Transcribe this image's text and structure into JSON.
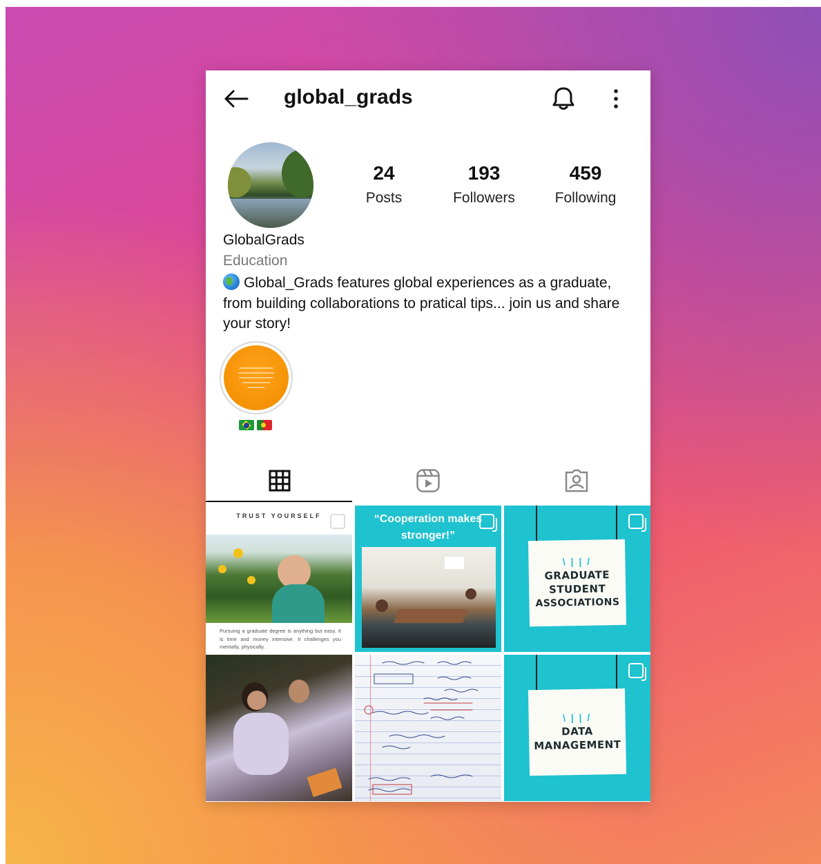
{
  "header": {
    "username": "global_grads"
  },
  "profile": {
    "stats": [
      {
        "value": "24",
        "label": "Posts"
      },
      {
        "value": "193",
        "label": "Followers"
      },
      {
        "value": "459",
        "label": "Following"
      }
    ],
    "display_name": "GlobalGrads",
    "category": "Education",
    "bio": "Global_Grads features global experiences as a graduate, from building collaborations to pratical tips... join us and share your story!"
  },
  "highlight": {
    "label_icons": [
      "brazil-flag",
      "portugal-flag"
    ],
    "cover_color": "#f79508"
  },
  "tabs": [
    {
      "name": "grid",
      "icon": "grid-icon",
      "active": true
    },
    {
      "name": "reels",
      "icon": "reels-icon",
      "active": false
    },
    {
      "name": "tagged",
      "icon": "tagged-icon",
      "active": false
    }
  ],
  "posts": {
    "p1": {
      "title": "TRUST YOURSELF",
      "caption": "Pursuing a graduate degree is anything but easy. It is time and money intensive. It challenges you mentally, physically."
    },
    "p2": {
      "title_line1": "“Cooperation makes",
      "title_line2": "stronger!”"
    },
    "p3": {
      "line1": "GRADUATE",
      "line2": "STUDENT",
      "line3": "ASSOCIATIONS"
    },
    "p6": {
      "line1": "DATA",
      "line2": "MANAGEMENT"
    }
  },
  "colors": {
    "post_teal": "#1fc2cf",
    "text_primary": "#111111",
    "text_secondary": "#777777"
  }
}
